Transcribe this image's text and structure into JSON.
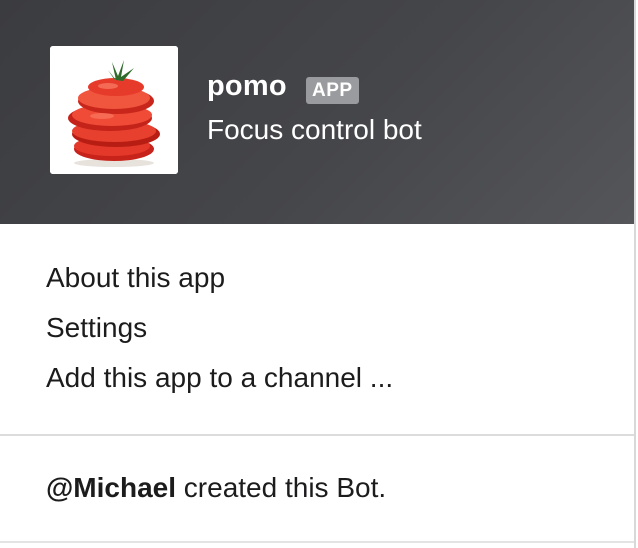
{
  "app": {
    "name": "pomo",
    "badge": "APP",
    "description": "Focus control bot",
    "avatar_icon": "tomato-icon"
  },
  "menu": {
    "items": [
      {
        "label": "About this app"
      },
      {
        "label": "Settings"
      },
      {
        "label": "Add this app to a channel ..."
      }
    ]
  },
  "footer": {
    "mention": "@Michael",
    "text": " created this Bot."
  },
  "colors": {
    "header_bg": "#45464a",
    "badge_bg": "#9a9b9e",
    "text": "#1d1c1d"
  }
}
